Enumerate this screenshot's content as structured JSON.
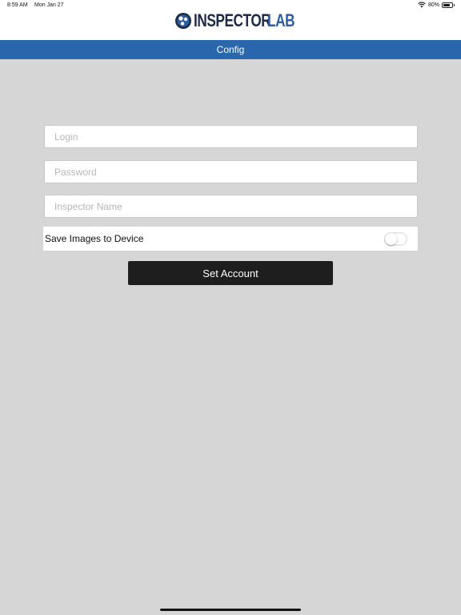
{
  "status_bar": {
    "time": "8:59 AM",
    "date": "Mon Jan 27",
    "battery": "80%",
    "battery_level": 0.8
  },
  "header": {
    "logo_inspector": "INSPECTOR",
    "logo_lab": "LAB"
  },
  "nav": {
    "title": "Config"
  },
  "form": {
    "login": {
      "value": "",
      "placeholder": "Login"
    },
    "password": {
      "value": "",
      "placeholder": "Password"
    },
    "inspector_name": {
      "value": "",
      "placeholder": "Inspector Name"
    },
    "save_images": {
      "label": "Save Images to Device",
      "enabled": false
    },
    "submit_label": "Set Account"
  },
  "colors": {
    "nav_bar": "#2a66ac",
    "background": "#d6d6d6",
    "button": "#1e1e1e",
    "logo_dark": "#1d2b4a",
    "logo_blue": "#2d5d9f"
  }
}
